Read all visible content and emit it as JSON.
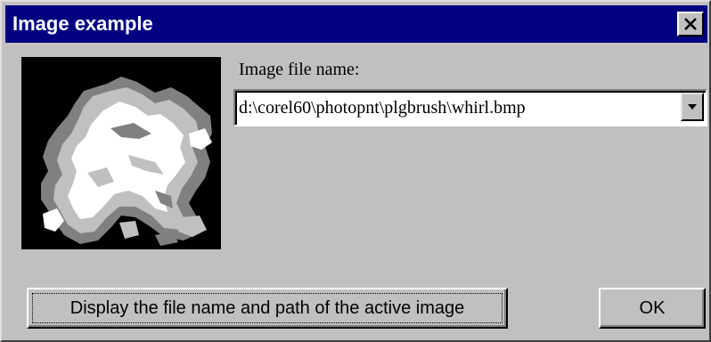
{
  "window": {
    "title": "Image example"
  },
  "icons": {
    "close": "close-icon",
    "dropdown": "chevron-down-icon"
  },
  "colors": {
    "titlebar": "#000080",
    "face": "#c0c0c0",
    "image_background": "#000000",
    "whirl_dark": "#808080",
    "whirl_mid": "#c0c0c0",
    "whirl_light": "#ffffff"
  },
  "form": {
    "filename_label": "Image file name:",
    "filename_value": "d:\\corel60\\photopnt\\plgbrush\\whirl.bmp"
  },
  "buttons": {
    "display_label": "Display the file name and path of the active image",
    "ok_label": "OK"
  }
}
